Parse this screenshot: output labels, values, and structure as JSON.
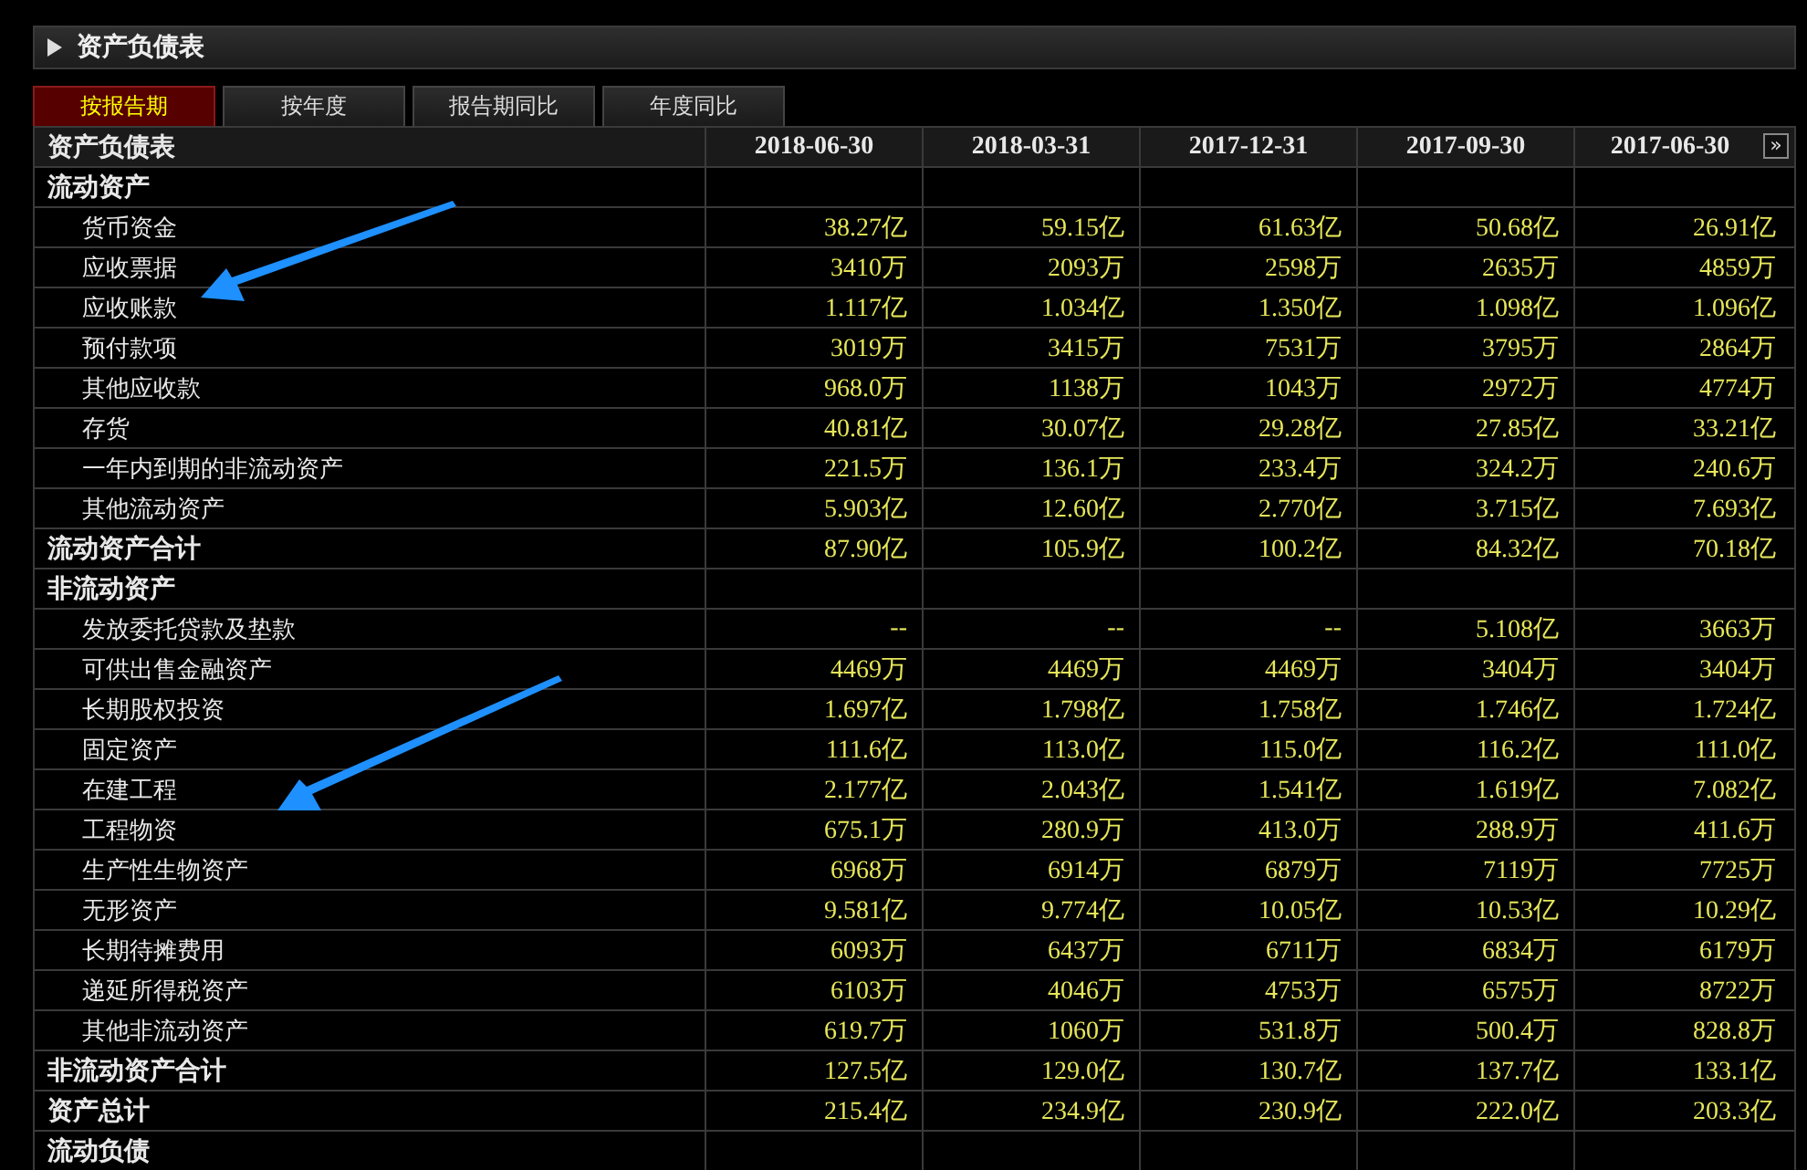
{
  "panel": {
    "title": "资产负债表"
  },
  "tabs": [
    {
      "label": "按报告期",
      "selected": true
    },
    {
      "label": "按年度",
      "selected": false
    },
    {
      "label": "报告期同比",
      "selected": false
    },
    {
      "label": "年度同比",
      "selected": false
    }
  ],
  "table": {
    "columns": [
      "资产负债表",
      "2018-06-30",
      "2018-03-31",
      "2017-12-31",
      "2017-09-30",
      "2017-06-30"
    ],
    "scroll_button": "»",
    "rows": [
      {
        "kind": "section",
        "label": "流动资产"
      },
      {
        "kind": "item",
        "label": "货币资金",
        "values": [
          "38.27亿",
          "59.15亿",
          "61.63亿",
          "50.68亿",
          "26.91亿"
        ]
      },
      {
        "kind": "item",
        "label": "应收票据",
        "values": [
          "3410万",
          "2093万",
          "2598万",
          "2635万",
          "4859万"
        ]
      },
      {
        "kind": "item",
        "label": "应收账款",
        "values": [
          "1.117亿",
          "1.034亿",
          "1.350亿",
          "1.098亿",
          "1.096亿"
        ]
      },
      {
        "kind": "item",
        "label": "预付款项",
        "values": [
          "3019万",
          "3415万",
          "7531万",
          "3795万",
          "2864万"
        ]
      },
      {
        "kind": "item",
        "label": "其他应收款",
        "values": [
          "968.0万",
          "1138万",
          "1043万",
          "2972万",
          "4774万"
        ]
      },
      {
        "kind": "item",
        "label": "存货",
        "values": [
          "40.81亿",
          "30.07亿",
          "29.28亿",
          "27.85亿",
          "33.21亿"
        ]
      },
      {
        "kind": "item",
        "label": "一年内到期的非流动资产",
        "values": [
          "221.5万",
          "136.1万",
          "233.4万",
          "324.2万",
          "240.6万"
        ]
      },
      {
        "kind": "item",
        "label": "其他流动资产",
        "values": [
          "5.903亿",
          "12.60亿",
          "2.770亿",
          "3.715亿",
          "7.693亿"
        ]
      },
      {
        "kind": "total",
        "label": "流动资产合计",
        "values": [
          "87.90亿",
          "105.9亿",
          "100.2亿",
          "84.32亿",
          "70.18亿"
        ]
      },
      {
        "kind": "section",
        "label": "非流动资产"
      },
      {
        "kind": "item",
        "label": "发放委托贷款及垫款",
        "values": [
          "--",
          "--",
          "--",
          "5.108亿",
          "3663万"
        ]
      },
      {
        "kind": "item",
        "label": "可供出售金融资产",
        "values": [
          "4469万",
          "4469万",
          "4469万",
          "3404万",
          "3404万"
        ]
      },
      {
        "kind": "item",
        "label": "长期股权投资",
        "values": [
          "1.697亿",
          "1.798亿",
          "1.758亿",
          "1.746亿",
          "1.724亿"
        ]
      },
      {
        "kind": "item",
        "label": "固定资产",
        "values": [
          "111.6亿",
          "113.0亿",
          "115.0亿",
          "116.2亿",
          "111.0亿"
        ]
      },
      {
        "kind": "item",
        "label": "在建工程",
        "values": [
          "2.177亿",
          "2.043亿",
          "1.541亿",
          "1.619亿",
          "7.082亿"
        ]
      },
      {
        "kind": "item",
        "label": "工程物资",
        "values": [
          "675.1万",
          "280.9万",
          "413.0万",
          "288.9万",
          "411.6万"
        ]
      },
      {
        "kind": "item",
        "label": "生产性生物资产",
        "values": [
          "6968万",
          "6914万",
          "6879万",
          "7119万",
          "7725万"
        ]
      },
      {
        "kind": "item",
        "label": "无形资产",
        "values": [
          "9.581亿",
          "9.774亿",
          "10.05亿",
          "10.53亿",
          "10.29亿"
        ]
      },
      {
        "kind": "item",
        "label": "长期待摊费用",
        "values": [
          "6093万",
          "6437万",
          "6711万",
          "6834万",
          "6179万"
        ]
      },
      {
        "kind": "item",
        "label": "递延所得税资产",
        "values": [
          "6103万",
          "4046万",
          "4753万",
          "6575万",
          "8722万"
        ]
      },
      {
        "kind": "item",
        "label": "其他非流动资产",
        "values": [
          "619.7万",
          "1060万",
          "531.8万",
          "500.4万",
          "828.8万"
        ]
      },
      {
        "kind": "total",
        "label": "非流动资产合计",
        "values": [
          "127.5亿",
          "129.0亿",
          "130.7亿",
          "137.7亿",
          "133.1亿"
        ]
      },
      {
        "kind": "total",
        "label": "资产总计",
        "values": [
          "215.4亿",
          "234.9亿",
          "230.9亿",
          "222.0亿",
          "203.3亿"
        ]
      },
      {
        "kind": "section",
        "label": "流动负债"
      }
    ]
  }
}
